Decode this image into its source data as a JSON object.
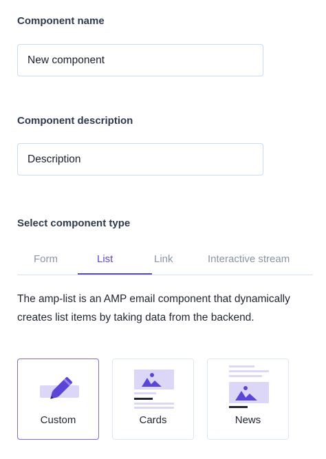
{
  "name_section": {
    "label": "Component name",
    "value": "New component"
  },
  "description_section": {
    "label": "Component description",
    "value": "Description"
  },
  "type_section": {
    "label": "Select component type",
    "tabs": [
      {
        "label": "Form"
      },
      {
        "label": "List"
      },
      {
        "label": "Link"
      },
      {
        "label": "Interactive stream"
      }
    ],
    "active_tab": "List",
    "description": "The amp-list is an AMP email component that dynamically creates list items by taking data from the backend."
  },
  "templates": [
    {
      "label": "Custom",
      "icon": "pencil-icon",
      "selected": true
    },
    {
      "label": "Cards",
      "icon": "cards-icon",
      "selected": false
    },
    {
      "label": "News",
      "icon": "news-icon",
      "selected": false
    }
  ],
  "colors": {
    "accent": "#5b45d6",
    "illustration_bg": "#dcd7f7",
    "border": "#c9dcef"
  }
}
